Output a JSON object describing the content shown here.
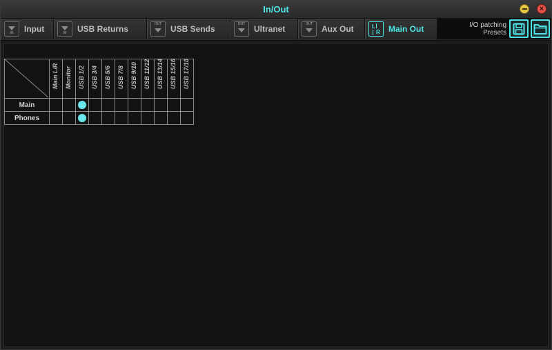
{
  "window": {
    "title": "In/Out"
  },
  "tabs": [
    {
      "label": "Input",
      "icon": "input-icon",
      "active": false
    },
    {
      "label": "USB Returns",
      "icon": "usb-returns-icon",
      "active": false
    },
    {
      "label": "USB Sends",
      "icon": "usb-sends-icon",
      "active": false
    },
    {
      "label": "Ultranet",
      "icon": "ultranet-icon",
      "active": false
    },
    {
      "label": "Aux Out",
      "icon": "aux-out-icon",
      "active": false
    },
    {
      "label": "Main Out",
      "icon": "main-out-lr-icon",
      "active": true
    }
  ],
  "icon_text": {
    "in": "IN",
    "out": "OUT",
    "l": "L",
    "r": "R"
  },
  "presets": {
    "label_line1": "I/O patching",
    "label_line2": "Presets",
    "save_icon": "save-icon",
    "open_icon": "folder-open-icon"
  },
  "matrix": {
    "columns": [
      "Main L/R",
      "Monitor",
      "USB 1/2",
      "USB 3/4",
      "USB 5/6",
      "USB 7/8",
      "USB 9/10",
      "USB 11/12",
      "USB 13/14",
      "USB 15/16",
      "USB 17/18"
    ],
    "rows": [
      {
        "label": "Main",
        "selected_column": 2
      },
      {
        "label": "Phones",
        "selected_column": 2
      }
    ]
  },
  "colors": {
    "accent": "#4ee6e6",
    "dot": "#6ae6ee",
    "background": "#131313"
  }
}
